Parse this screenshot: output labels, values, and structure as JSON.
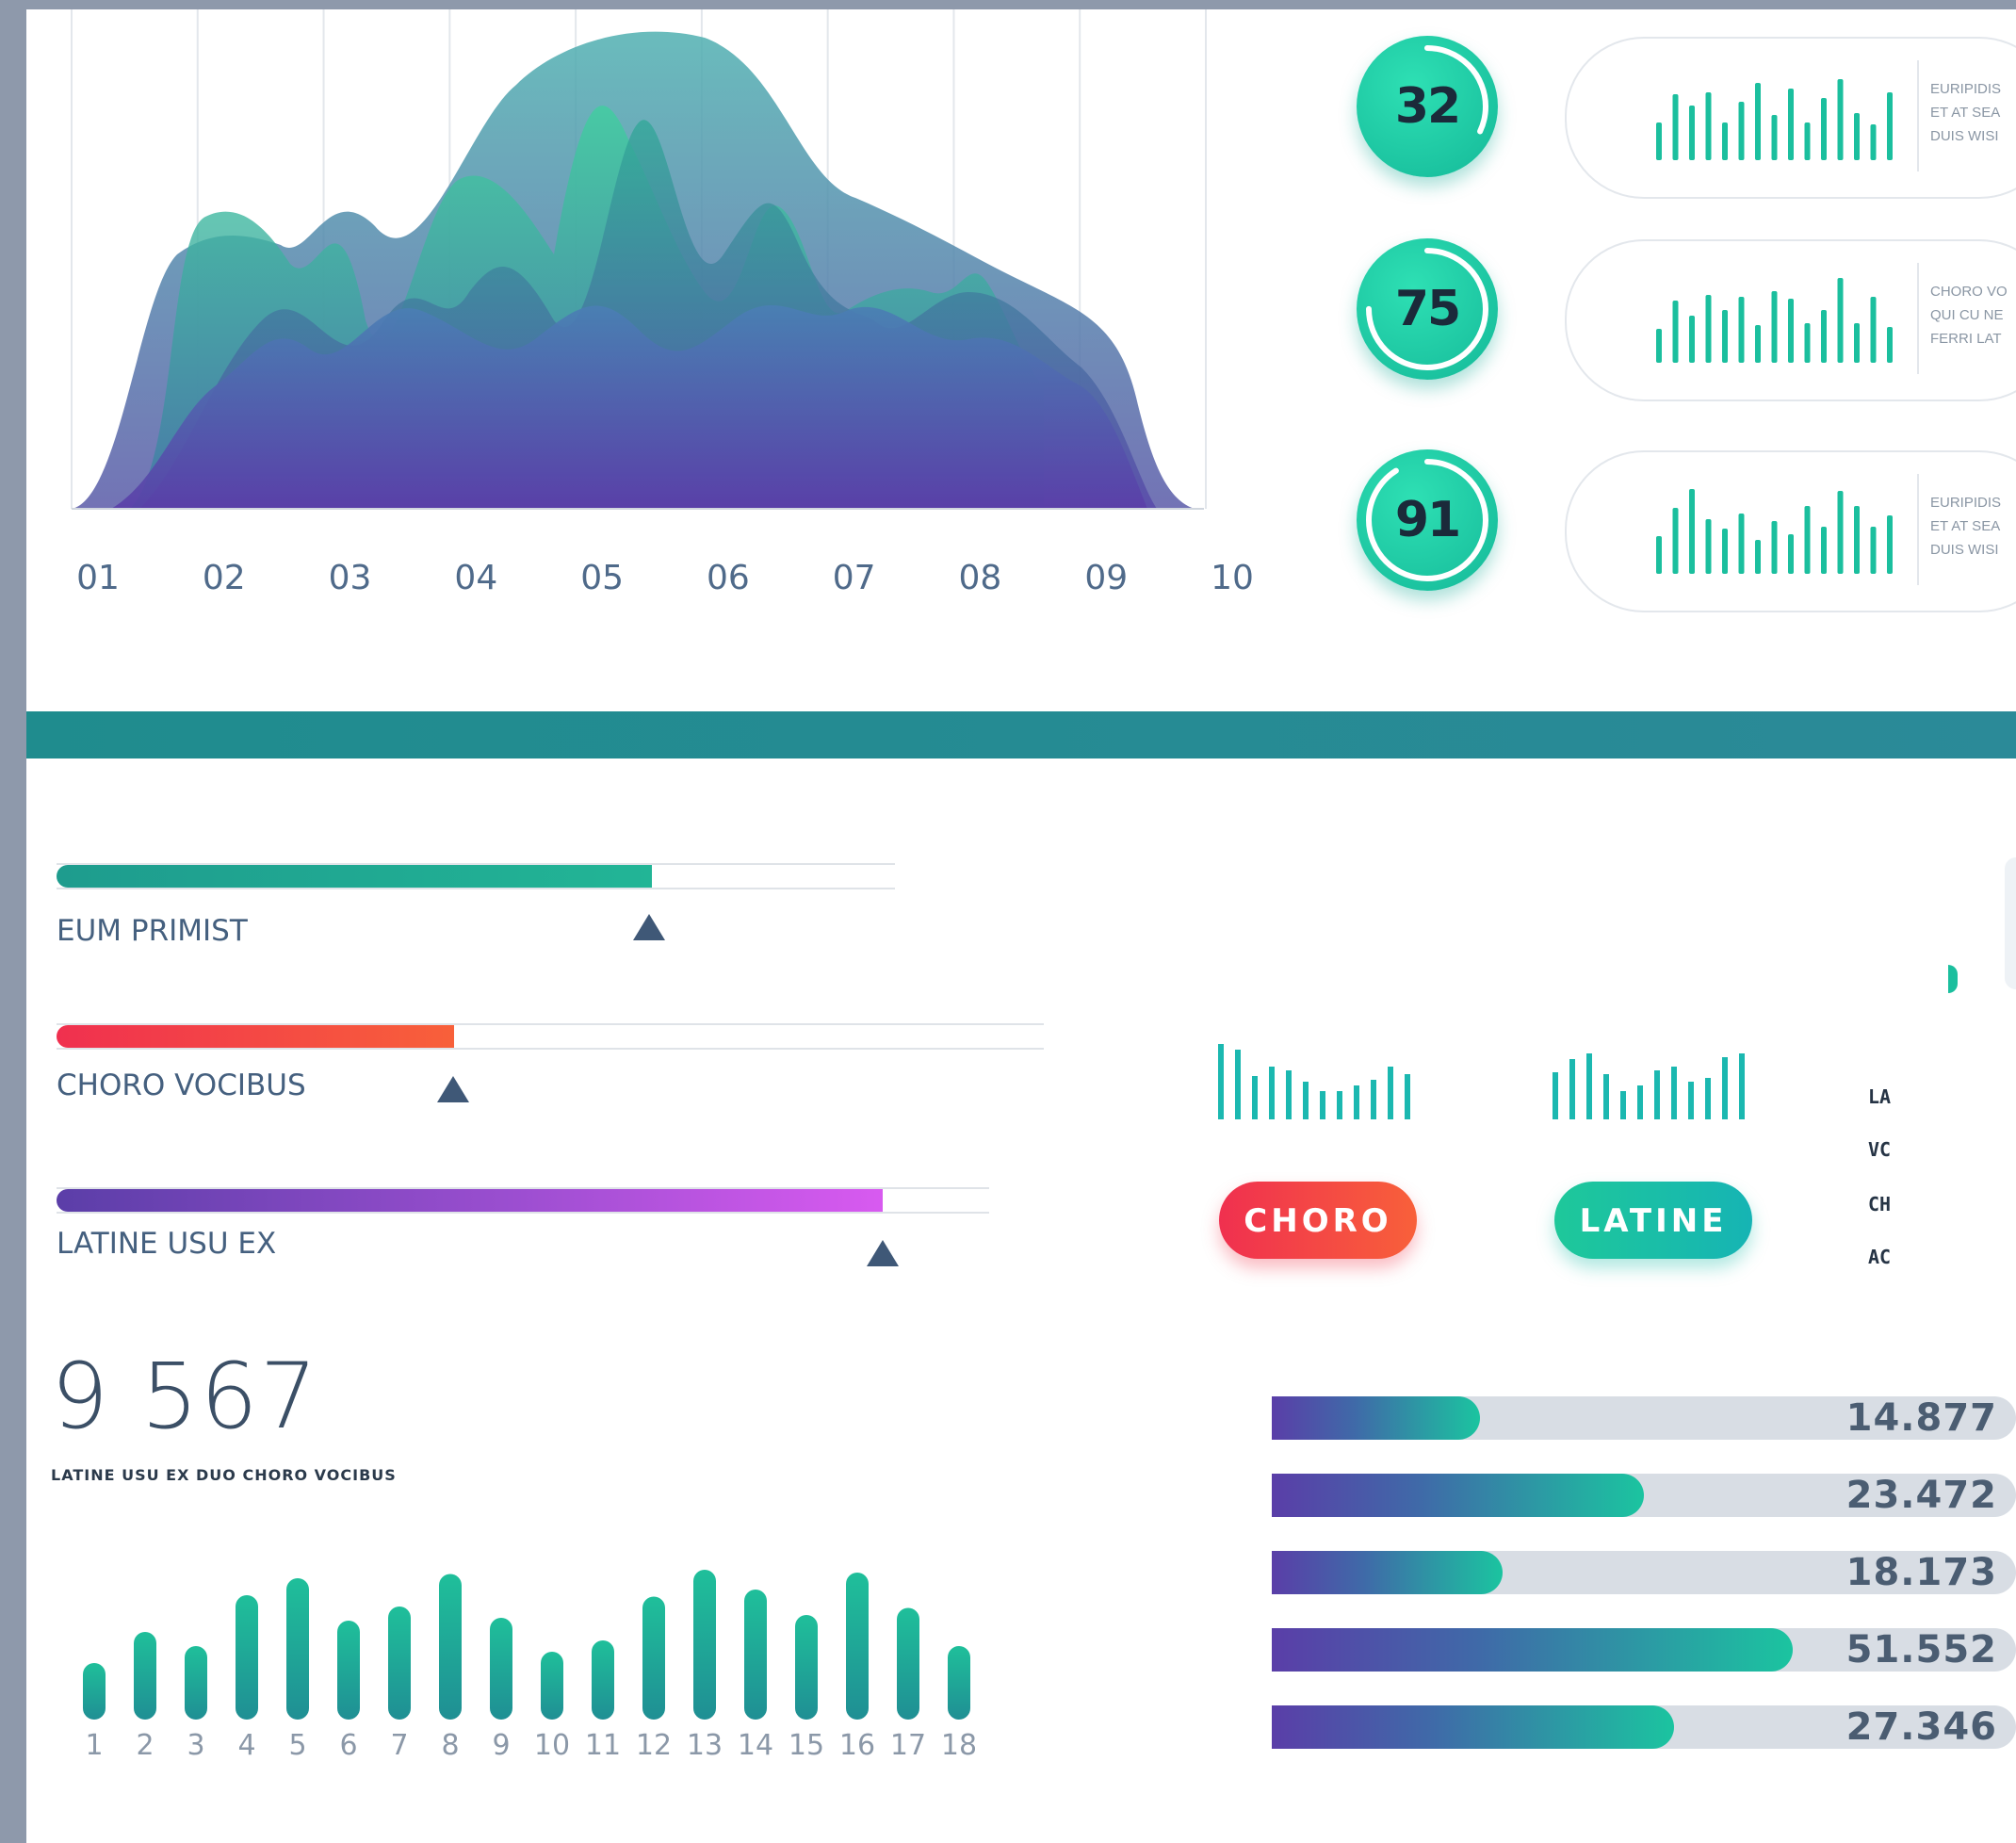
{
  "colors": {
    "teal": "#1bbf9e",
    "teal_dark": "#1e9a92",
    "purple": "#5a3ea8",
    "red": "#f0344d",
    "magenta": "#d85af0",
    "divider": "#2a8a92"
  },
  "area_chart": {
    "x_labels": [
      "01",
      "02",
      "03",
      "04",
      "05",
      "06",
      "07",
      "08",
      "09",
      "10"
    ]
  },
  "rings": [
    {
      "value": "32",
      "progress": 0.32,
      "text": [
        "EURIPIDIS",
        "ET AT SEA",
        "DUIS WISI"
      ]
    },
    {
      "value": "75",
      "progress": 0.75,
      "text": [
        "CHORO VO",
        "QUI CU NE",
        "FERRI LAT"
      ]
    },
    {
      "value": "91",
      "progress": 0.91,
      "text": [
        "EURIPIDIS",
        "ET AT SEA",
        "DUIS WISI"
      ]
    }
  ],
  "progress_bars": [
    {
      "label": "EUM PRIMIST",
      "value": 0.71
    },
    {
      "label": "CHORO VOCIBUS",
      "value": 0.41
    },
    {
      "label": "LATINE USU EX",
      "value": 0.91
    }
  ],
  "buttons": {
    "choro": "CHORO",
    "latine": "LATINE"
  },
  "side_letters": [
    "LA",
    "VC",
    "CH",
    "AC"
  ],
  "stat": {
    "value": "9 567",
    "caption": "LATINE USU EX DUO CHORO VOCIBUS"
  },
  "column_chart": {
    "labels": [
      "1",
      "2",
      "3",
      "4",
      "5",
      "6",
      "7",
      "8",
      "9",
      "10",
      "11",
      "12",
      "13",
      "14",
      "15",
      "16",
      "17",
      "18"
    ],
    "values": [
      40,
      62,
      52,
      88,
      100,
      70,
      80,
      103,
      72,
      48,
      56,
      87,
      106,
      92,
      74,
      104,
      79,
      52
    ]
  },
  "h_bars": [
    {
      "value": "14.877",
      "progress": 0.28
    },
    {
      "value": "23.472",
      "progress": 0.5
    },
    {
      "value": "18.173",
      "progress": 0.31
    },
    {
      "value": "51.552",
      "progress": 0.7
    },
    {
      "value": "27.346",
      "progress": 0.54
    }
  ]
}
